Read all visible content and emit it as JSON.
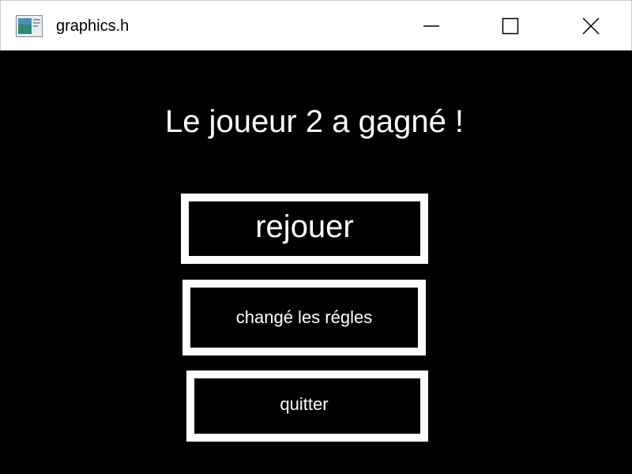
{
  "window": {
    "title": "graphics.h",
    "icon": "graphics-app-icon",
    "controls": {
      "minimize": "minimize-icon",
      "maximize": "maximize-icon",
      "close": "close-icon"
    }
  },
  "game": {
    "result_message": "Le joueur 2 a gagné !",
    "buttons": {
      "replay": "rejouer",
      "change_rules": "changé les régles",
      "quit": "quitter"
    }
  },
  "colors": {
    "background": "#000000",
    "foreground": "#ffffff",
    "titlebar": "#ffffff"
  }
}
